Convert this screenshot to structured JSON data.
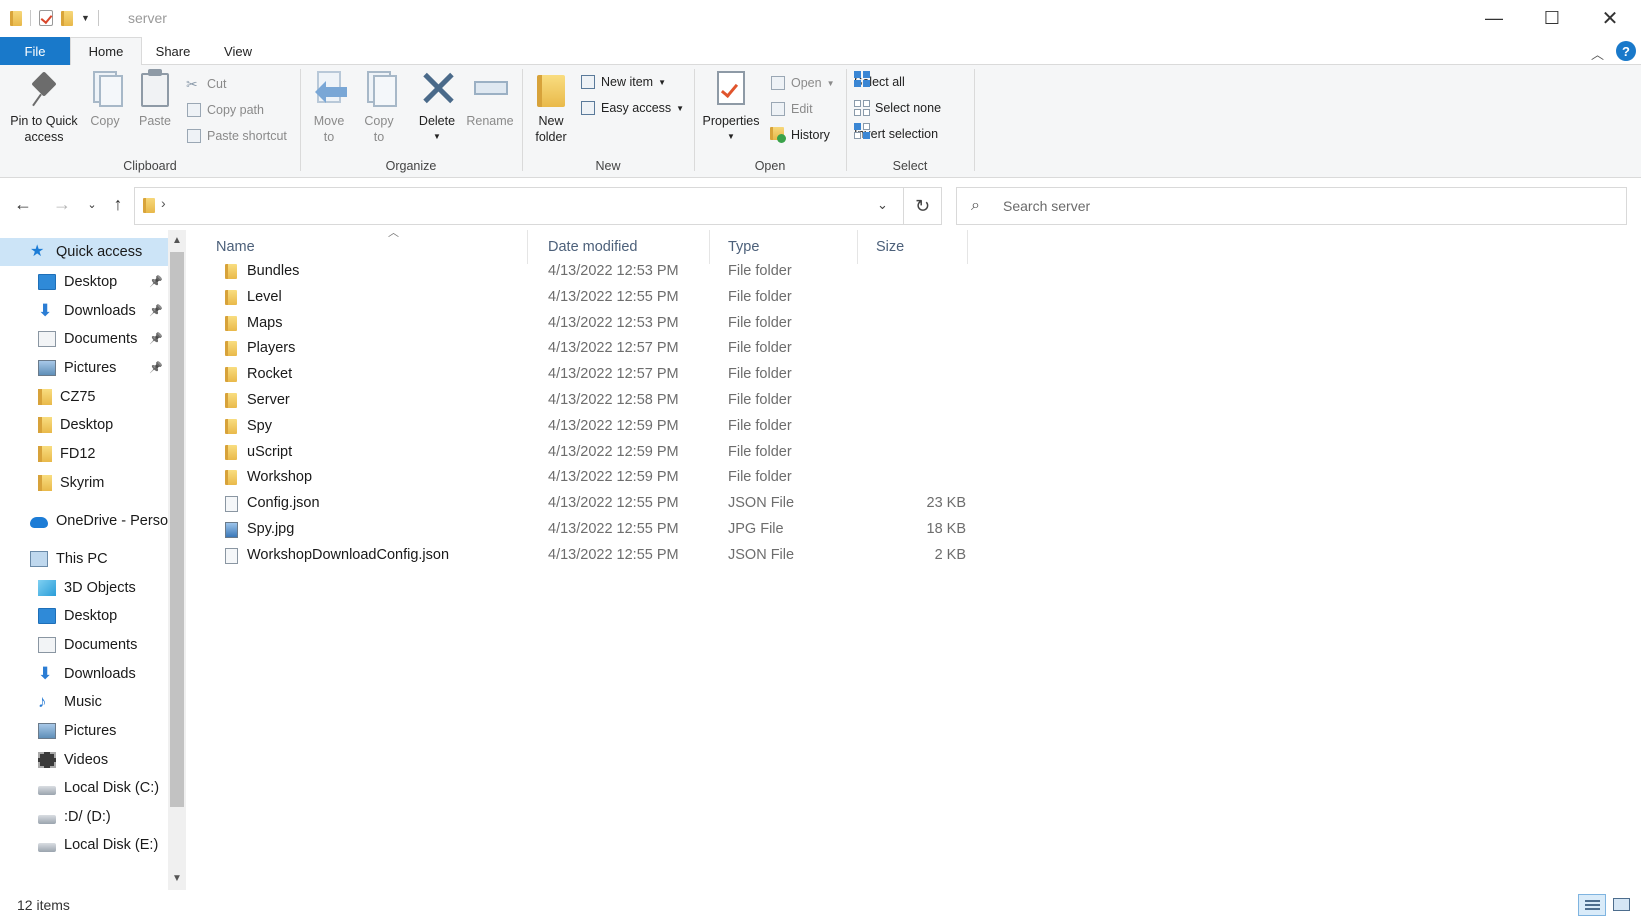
{
  "window": {
    "title": "server",
    "minimize_glyph": "—",
    "maximize_glyph": "☐",
    "close_glyph": "✕"
  },
  "ribbon_tabs": {
    "file": "File",
    "home": "Home",
    "share": "Share",
    "view": "View"
  },
  "ribbon": {
    "clipboard": {
      "group": "Clipboard",
      "pin_line1": "Pin to Quick",
      "pin_line2": "access",
      "copy": "Copy",
      "paste": "Paste",
      "cut": "Cut",
      "copy_path": "Copy path",
      "paste_shortcut": "Paste shortcut"
    },
    "organize": {
      "group": "Organize",
      "move_line1": "Move",
      "move_line2": "to",
      "copy_line1": "Copy",
      "copy_line2": "to",
      "delete": "Delete",
      "rename": "Rename"
    },
    "new": {
      "group": "New",
      "new_folder_line1": "New",
      "new_folder_line2": "folder",
      "new_item": "New item",
      "easy_access": "Easy access"
    },
    "open": {
      "group": "Open",
      "properties": "Properties",
      "open": "Open",
      "edit": "Edit",
      "history": "History"
    },
    "select": {
      "group": "Select",
      "select_all": "Select all",
      "select_none": "Select none",
      "invert_selection": "Invert selection"
    }
  },
  "address_bar": {
    "path_separator": "›",
    "search_placeholder": "Search server"
  },
  "nav_pane": {
    "items": [
      {
        "label": "Quick access",
        "icon": "star-icon",
        "level": 0,
        "selected": true
      },
      {
        "label": "Desktop",
        "icon": "desktop-icon",
        "level": 1,
        "pinned": true
      },
      {
        "label": "Downloads",
        "icon": "download-icon",
        "level": 1,
        "pinned": true
      },
      {
        "label": "Documents",
        "icon": "documents-icon",
        "level": 1,
        "pinned": true
      },
      {
        "label": "Pictures",
        "icon": "pictures-icon",
        "level": 1,
        "pinned": true
      },
      {
        "label": "CZ75",
        "icon": "folder-icon",
        "level": 1
      },
      {
        "label": "Desktop",
        "icon": "folder-icon",
        "level": 1
      },
      {
        "label": "FD12",
        "icon": "folder-icon",
        "level": 1
      },
      {
        "label": "Skyrim",
        "icon": "folder-icon",
        "level": 1
      },
      {
        "label": "OneDrive - Person",
        "icon": "onedrive-icon",
        "level": 0
      },
      {
        "label": "This PC",
        "icon": "this-pc-icon",
        "level": 0
      },
      {
        "label": "3D Objects",
        "icon": "3d-objects-icon",
        "level": 1
      },
      {
        "label": "Desktop",
        "icon": "desktop-icon",
        "level": 1
      },
      {
        "label": "Documents",
        "icon": "documents-icon",
        "level": 1
      },
      {
        "label": "Downloads",
        "icon": "download-icon",
        "level": 1
      },
      {
        "label": "Music",
        "icon": "music-icon",
        "level": 1
      },
      {
        "label": "Pictures",
        "icon": "pictures-icon",
        "level": 1
      },
      {
        "label": "Videos",
        "icon": "videos-icon",
        "level": 1
      },
      {
        "label": "Local Disk (C:)",
        "icon": "disk-icon",
        "level": 1
      },
      {
        "label": ":D/ (D:)",
        "icon": "disk-icon",
        "level": 1
      },
      {
        "label": "Local Disk (E:)",
        "icon": "disk-icon",
        "level": 1
      }
    ]
  },
  "file_list": {
    "columns": {
      "name": "Name",
      "date": "Date modified",
      "type": "Type",
      "size": "Size"
    },
    "rows": [
      {
        "name": "Bundles",
        "date": "4/13/2022 12:53 PM",
        "type": "File folder",
        "size": "",
        "kind": "folder"
      },
      {
        "name": "Level",
        "date": "4/13/2022 12:55 PM",
        "type": "File folder",
        "size": "",
        "kind": "folder"
      },
      {
        "name": "Maps",
        "date": "4/13/2022 12:53 PM",
        "type": "File folder",
        "size": "",
        "kind": "folder"
      },
      {
        "name": "Players",
        "date": "4/13/2022 12:57 PM",
        "type": "File folder",
        "size": "",
        "kind": "folder"
      },
      {
        "name": "Rocket",
        "date": "4/13/2022 12:57 PM",
        "type": "File folder",
        "size": "",
        "kind": "folder"
      },
      {
        "name": "Server",
        "date": "4/13/2022 12:58 PM",
        "type": "File folder",
        "size": "",
        "kind": "folder"
      },
      {
        "name": "Spy",
        "date": "4/13/2022 12:59 PM",
        "type": "File folder",
        "size": "",
        "kind": "folder"
      },
      {
        "name": "uScript",
        "date": "4/13/2022 12:59 PM",
        "type": "File folder",
        "size": "",
        "kind": "folder"
      },
      {
        "name": "Workshop",
        "date": "4/13/2022 12:59 PM",
        "type": "File folder",
        "size": "",
        "kind": "folder"
      },
      {
        "name": "Config.json",
        "date": "4/13/2022 12:55 PM",
        "type": "JSON File",
        "size": "23 KB",
        "kind": "json"
      },
      {
        "name": "Spy.jpg",
        "date": "4/13/2022 12:55 PM",
        "type": "JPG File",
        "size": "18 KB",
        "kind": "jpg"
      },
      {
        "name": "WorkshopDownloadConfig.json",
        "date": "4/13/2022 12:55 PM",
        "type": "JSON File",
        "size": "2 KB",
        "kind": "json"
      }
    ]
  },
  "status_bar": {
    "item_count": "12 items"
  }
}
